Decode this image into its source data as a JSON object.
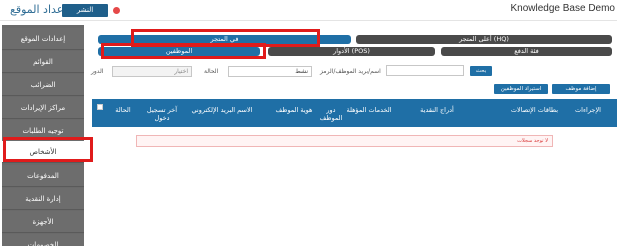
{
  "header": {
    "title": "إعداد الموقع",
    "publish_label": "النشر",
    "app_name": "Knowledge Base Demo"
  },
  "sidebar": {
    "items": [
      {
        "label": "إعدادات الموقع"
      },
      {
        "label": "القوائم"
      },
      {
        "label": "الضرائب"
      },
      {
        "label": "مراكز الإيرادات"
      },
      {
        "label": "توجيه الطلبات"
      },
      {
        "label": "الأشخاص"
      },
      {
        "label": "المدفوعات"
      },
      {
        "label": "إدارة النقدية"
      },
      {
        "label": "الأجهزة"
      },
      {
        "label": "الخصومات"
      }
    ]
  },
  "tabs": {
    "row1": [
      {
        "label": "في المتجر"
      },
      {
        "label": "(HQ) أعلى المتجر"
      }
    ],
    "row2": [
      {
        "label": "الموظفين"
      },
      {
        "label": "(POS) الأدوار"
      },
      {
        "label": "فئة الدفع"
      }
    ]
  },
  "filters": {
    "role_label": "الدور",
    "role_placeholder": "اختيار",
    "status_label": "الحالة",
    "status_value": "نشط",
    "search_label": "اسم/بريد الموظف/الرمز",
    "search_value": "",
    "search_button": "بحث"
  },
  "actions": {
    "add_employee": "إضافة موظف",
    "import_employees": "استيراد الموظفين"
  },
  "table": {
    "headers": [
      "الإجراءات",
      "بطاقات الإتصالات",
      "أدراج النقدية",
      "الخدمات المؤهلة",
      "دور الموظف",
      "هوية الموظف",
      "الاسم البريد الإلكتروني",
      "آخر تسجيل دخول",
      "الحالة"
    ],
    "empty_message": "لا توجد سجلات"
  }
}
